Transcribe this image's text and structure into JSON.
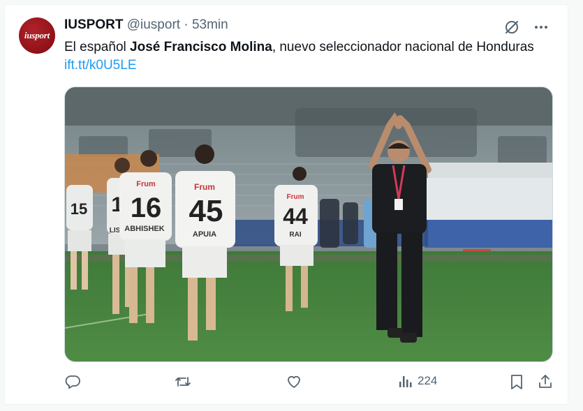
{
  "account": {
    "avatar_text": "iusport",
    "display_name": "IUSPORT",
    "handle": "@iusport",
    "separator": "·",
    "time": "53min"
  },
  "tweet": {
    "text_before": "El español ",
    "text_bold": "José Francisco Molina",
    "text_after": ", nuevo seleccionador nacional de Honduras ",
    "link": "ift.tt/k0U5LE"
  },
  "media": {
    "jersey_numbers": [
      "15",
      "17",
      "16",
      "45",
      "44"
    ],
    "jersey_names": [
      "LISTON",
      "ABHISHEK",
      "APUIA",
      "RAI"
    ],
    "sponsor_text": "Frum"
  },
  "actions": {
    "reply_icon": "reply-icon",
    "repost_icon": "repost-icon",
    "like_icon": "heart-icon",
    "views_icon": "views-icon",
    "views_count": "224",
    "bookmark_icon": "bookmark-icon",
    "share_icon": "share-icon"
  },
  "colors": {
    "link": "#1d9bf0",
    "muted": "#536471",
    "avatar": "#9b1b21"
  }
}
